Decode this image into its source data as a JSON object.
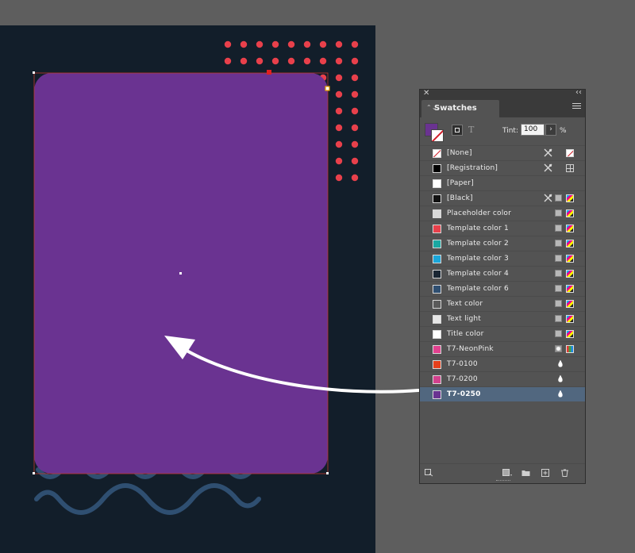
{
  "canvas": {
    "background": "#5e5e5e",
    "page_color": "#121e2a",
    "rectangle_fill": "#6a3391",
    "dot_color": "#e8404b",
    "wave_color": "#2f4f71",
    "arrow_color": "#ffffff"
  },
  "panel": {
    "close_glyph": "✕",
    "collapse_glyph": "‹‹",
    "tab_arrows": "⌃⌄",
    "title": "Swatches",
    "tint_label": "Tint:",
    "tint_value": "100",
    "tint_stepper": "›",
    "tint_unit": "%",
    "text_mode_glyph": "T",
    "icons": {
      "menu": "hamburger-menu-icon",
      "fill_stroke": "fill-stroke-icon",
      "container": "formatting-container-icon",
      "text": "formatting-text-icon",
      "show_kinds": "show-swatch-kinds-icon",
      "new_group": "new-color-group-icon",
      "new_swatch": "new-swatch-icon",
      "delete": "delete-swatch-icon",
      "import": "import-swatches-icon"
    }
  },
  "swatches": [
    {
      "name": "[None]",
      "color": "#ffffff",
      "kind": "none",
      "locked": true,
      "mode": "none"
    },
    {
      "name": "[Registration]",
      "color": "#000000",
      "kind": "reg",
      "locked": true,
      "mode": "reg"
    },
    {
      "name": "[Paper]",
      "color": "#ffffff",
      "kind": "plain",
      "locked": false,
      "mode": ""
    },
    {
      "name": "[Black]",
      "color": "#111111",
      "kind": "process",
      "locked": true,
      "mode": "cmyk"
    },
    {
      "name": "Placeholder color",
      "color": "#d9d9d9",
      "kind": "process",
      "locked": false,
      "mode": "cmyk"
    },
    {
      "name": "Template color 1",
      "color": "#e8404b",
      "kind": "process",
      "locked": false,
      "mode": "cmyk"
    },
    {
      "name": "Template color 2",
      "color": "#1aa8a2",
      "kind": "process",
      "locked": false,
      "mode": "cmyk"
    },
    {
      "name": "Template color 3",
      "color": "#1aa6d9",
      "kind": "process",
      "locked": false,
      "mode": "cmyk"
    },
    {
      "name": "Template color 4",
      "color": "#1a2633",
      "kind": "process",
      "locked": false,
      "mode": "cmyk"
    },
    {
      "name": "Template color 6",
      "color": "#2f4f71",
      "kind": "process",
      "locked": false,
      "mode": "cmyk"
    },
    {
      "name": "Text color",
      "color": "#5a5a5a",
      "kind": "process",
      "locked": false,
      "mode": "cmyk"
    },
    {
      "name": "Text light",
      "color": "#e6e6e6",
      "kind": "process",
      "locked": false,
      "mode": "cmyk"
    },
    {
      "name": "Title color",
      "color": "#ffffff",
      "kind": "process",
      "locked": false,
      "mode": "cmyk"
    },
    {
      "name": "T7-NeonPink",
      "color": "#e2418f",
      "kind": "spot",
      "locked": false,
      "mode": "rgb"
    },
    {
      "name": "T7-0100",
      "color": "#e4401c",
      "kind": "mixed",
      "locked": false,
      "mode": ""
    },
    {
      "name": "T7-0200",
      "color": "#d2418d",
      "kind": "mixed",
      "locked": false,
      "mode": ""
    },
    {
      "name": "T7-0250",
      "color": "#6a3391",
      "kind": "mixed",
      "locked": false,
      "mode": "",
      "selected": true
    }
  ]
}
